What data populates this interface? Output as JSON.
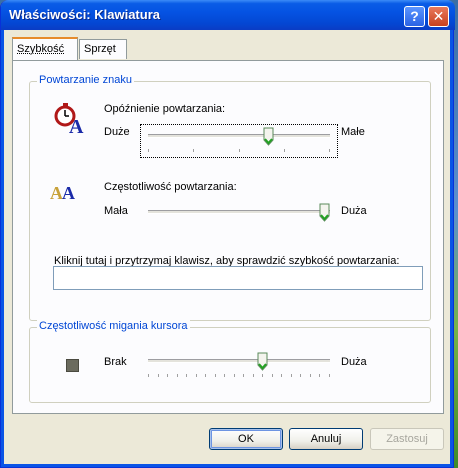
{
  "window": {
    "title": "Właściwości: Klawiatura",
    "help_glyph": "?",
    "close_glyph": "✕"
  },
  "tabs": [
    {
      "label": "Szybkość",
      "active": true
    },
    {
      "label": "Sprzęt",
      "active": false
    }
  ],
  "repeat_group": {
    "legend": "Powtarzanie znaku",
    "delay": {
      "label": "Opóźnienie powtarzania:",
      "left_label": "Duże",
      "right_label": "Małe",
      "value_fraction": 0.67,
      "icon": "stopwatch-A-icon"
    },
    "rate": {
      "label": "Częstotliwość powtarzania:",
      "left_label": "Mała",
      "right_label": "Duża",
      "value_fraction": 1.0,
      "icon": "repeating-AA-icon"
    },
    "test_label": "Kliknij tutaj i przytrzymaj klawisz, aby sprawdzić szybkość powtarzania:",
    "test_value": ""
  },
  "cursor_group": {
    "legend": "Częstotliwość migania kursora",
    "left_label": "Brak",
    "right_label": "Duża",
    "value_fraction": 0.64,
    "icon": "cursor-block-icon"
  },
  "buttons": {
    "ok": "OK",
    "cancel": "Anuluj",
    "apply": "Zastosuj"
  },
  "colors": {
    "titlebar": "#0553e3",
    "legend_text": "#0046d5",
    "active_tab_accent": "#e68b2c",
    "thumb_green": "#21a121"
  }
}
